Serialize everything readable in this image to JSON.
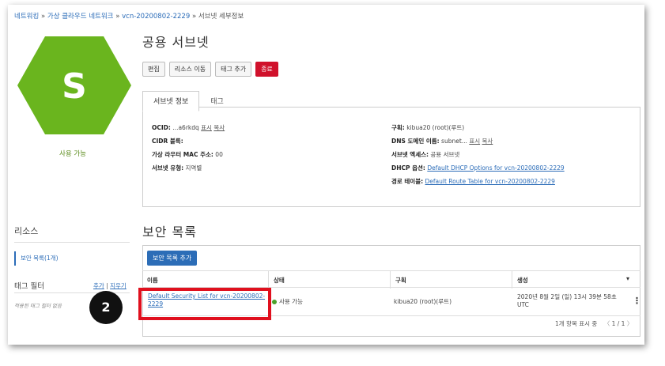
{
  "breadcrumb": {
    "networking": "네트워킹",
    "vcn_list": "가상 클라우드 네트워크",
    "vcn_name": "vcn-20200802-2229",
    "current": "서브넷 세부정보",
    "sep": "»"
  },
  "subnet": {
    "icon_letter": "S",
    "status": "사용 가능",
    "title": "공용 서브넷"
  },
  "actions": {
    "edit": "편집",
    "move": "리소스 이동",
    "add_tag": "태그 추가",
    "terminate": "종료"
  },
  "tabs": {
    "info": "서브넷 정보",
    "tags": "태그"
  },
  "info": {
    "ocid_label": "OCID:",
    "ocid_value": "...a6rkdq",
    "show": "표시",
    "copy": "복사",
    "cidr_label": "CIDR 블록:",
    "cidr_value": "",
    "mac_label": "가상 라우터 MAC 주소:",
    "mac_value": "00",
    "type_label": "서브넷 유형:",
    "type_value": "지역별",
    "compartment_label": "구획:",
    "compartment_value": "kibua20 (root)(루트)",
    "dns_label": "DNS 도메인 이름:",
    "dns_value": "subnet...",
    "access_label": "서브넷 액세스:",
    "access_value": "공용 서브넷",
    "dhcp_label": "DHCP 옵션:",
    "dhcp_value": "Default DHCP Options for vcn-20200802-2229",
    "route_label": "경로 테이블:",
    "route_value": "Default Route Table for vcn-20200802-2229"
  },
  "sidebar": {
    "resources": "리소스",
    "security_lists": "보안 목록(1개)",
    "tag_filter": "태그 필터",
    "add": "추가",
    "divider": "|",
    "clear": "지우기",
    "no_tags": "적용된 태그 필터 없음"
  },
  "security": {
    "title": "보안 목록",
    "add_button": "보안 목록 추가",
    "columns": [
      "이름",
      "상태",
      "구획",
      "생성"
    ],
    "sort_icon": "▾",
    "row": {
      "name": "Default Security List for vcn-20200802-2229",
      "status": "사용 가능",
      "compartment": "kibua20 (root)(루트)",
      "created": "2020년 8월 2일 (일) 13시 39분 58초 UTC",
      "menu": "⋮"
    },
    "count_text": "1개 항목 표시 중",
    "prev": "〈",
    "page": "1 / 1",
    "next": "〉"
  },
  "callout": {
    "number": "2"
  },
  "colors": {
    "hex": "#6ab51e",
    "danger": "#d0112b",
    "primary": "#2c6db7",
    "highlight": "#e0101e"
  }
}
